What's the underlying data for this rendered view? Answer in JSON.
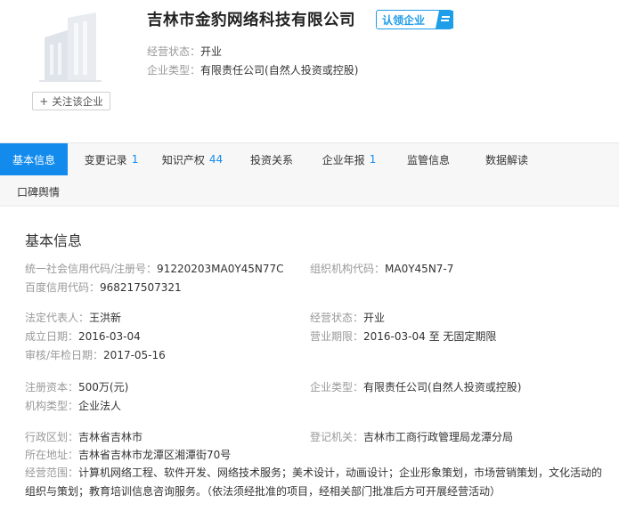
{
  "company": {
    "name": "吉林市金豹网络科技有限公司",
    "claim_label": "认领企业",
    "follow_label": "关注该企业",
    "status_key": "经营状态：",
    "status_val": "开业",
    "type_key": "企业类型：",
    "type_val": "有限责任公司(自然人投资或控股)"
  },
  "tabs": [
    {
      "label": "基本信息",
      "count": ""
    },
    {
      "label": "变更记录",
      "count": "1"
    },
    {
      "label": "知识产权",
      "count": "44"
    },
    {
      "label": "投资关系",
      "count": ""
    },
    {
      "label": "企业年报",
      "count": "1"
    },
    {
      "label": "监管信息",
      "count": ""
    },
    {
      "label": "数据解读",
      "count": ""
    },
    {
      "label": "口碑舆情",
      "count": ""
    }
  ],
  "section_title": "基本信息",
  "fields": {
    "credit_code": {
      "k": "统一社会信用代码/注册号：",
      "v": "91220203MA0Y45N77C"
    },
    "org_code": {
      "k": "组织机构代码：",
      "v": "MA0Y45N7-7"
    },
    "baidu_code": {
      "k": "百度信用代码：",
      "v": "968217507321"
    },
    "legal_rep": {
      "k": "法定代表人：",
      "v": "王洪新"
    },
    "biz_status": {
      "k": "经营状态：",
      "v": "开业"
    },
    "founded": {
      "k": "成立日期：",
      "v": "2016-03-04"
    },
    "term": {
      "k": "营业期限：",
      "v": "2016-03-04 至 无固定期限"
    },
    "audit_date": {
      "k": "审核/年检日期：",
      "v": "2017-05-16"
    },
    "capital": {
      "k": "注册资本：",
      "v": "500万(元)"
    },
    "ent_type": {
      "k": "企业类型：",
      "v": "有限责任公司(自然人投资或控股)"
    },
    "org_type": {
      "k": "机构类型：",
      "v": "企业法人"
    },
    "region": {
      "k": "行政区划：",
      "v": "吉林省吉林市"
    },
    "authority": {
      "k": "登记机关：",
      "v": "吉林市工商行政管理局龙潭分局"
    },
    "address": {
      "k": "所在地址：",
      "v": "吉林省吉林市龙潭区湘潭街70号"
    },
    "scope": {
      "k": "经营范围：",
      "v": "计算机网络工程、软件开发、网络技术服务；美术设计，动画设计；企业形象策划，市场营销策划，文化活动的组织与策划；教育培训信息咨询服务。（依法须经批准的项目，经相关部门批准后方可开展经营活动）"
    }
  }
}
